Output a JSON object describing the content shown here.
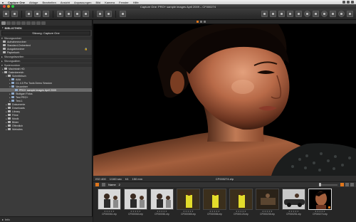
{
  "menubar": {
    "apple": "",
    "items": [
      "Capture One",
      "Ablage",
      "Bearbeiten",
      "Ansicht",
      "Anpassungen",
      "Bild",
      "Kamera",
      "Fenster",
      "Hilfe"
    ]
  },
  "window": {
    "title": "Capture One: PRO+ sample images April 2009 – CF000274"
  },
  "sidebar": {
    "panel_title": "BIBLIOTHEK",
    "catalog_name": "Sitzung: Capture One",
    "section_sitzungsordner": "Sitzungsordner",
    "session_items": [
      {
        "label": "Aufnahmeordner",
        "lock": ""
      },
      {
        "label": "Standard-Ordnertext",
        "lock": ""
      },
      {
        "label": "Ausgabeordner",
        "lock": "🔒"
      },
      {
        "label": "Papierkorb",
        "lock": ""
      }
    ],
    "section_favoriten": "Sitzungsfavoriten",
    "section_alben": "Sitzungsalben",
    "section_systemordner": "Systemordner",
    "tree": [
      {
        "indent": 0,
        "tw": "▸",
        "label": "Macintosh HD",
        "sel": false
      },
      {
        "indent": 0,
        "tw": "▾",
        "label": "Datenbereich",
        "sel": false
      },
      {
        "indent": 1,
        "tw": "▾",
        "label": "Schreibtisch",
        "sel": false
      },
      {
        "indent": 2,
        "tw": "▸",
        "label": "AAA",
        "sel": false
      },
      {
        "indent": 2,
        "tw": "▸",
        "label": "C1 4.5 Pro Tools Demo Session",
        "sel": false
      },
      {
        "indent": 2,
        "tw": "▾",
        "label": "Neuordner",
        "sel": false
      },
      {
        "indent": 3,
        "tw": "",
        "label": "PRO+ sample images April 2009",
        "sel": true
      },
      {
        "indent": 2,
        "tw": "▸",
        "label": "Stuttgart Fotos",
        "sel": false
      },
      {
        "indent": 2,
        "tw": "▸",
        "label": "Test PRO+",
        "sel": false
      },
      {
        "indent": 2,
        "tw": "▸",
        "label": "Test-1",
        "sel": false
      },
      {
        "indent": 1,
        "tw": "▸",
        "label": "Dokumente",
        "sel": false
      },
      {
        "indent": 1,
        "tw": "▸",
        "label": "Downloads",
        "sel": false
      },
      {
        "indent": 1,
        "tw": "▸",
        "label": "Library",
        "sel": false
      },
      {
        "indent": 1,
        "tw": "▸",
        "label": "Filme",
        "sel": false
      },
      {
        "indent": 1,
        "tw": "▸",
        "label": "Musik",
        "sel": false
      },
      {
        "indent": 1,
        "tw": "▸",
        "label": "Bilder",
        "sel": false
      },
      {
        "indent": 1,
        "tw": "▸",
        "label": "Öffentlich",
        "sel": false
      },
      {
        "indent": 1,
        "tw": "▸",
        "label": "Websites",
        "sel": false
      }
    ],
    "bottom_label": "Info"
  },
  "viewer": {
    "iso": "ISO 400",
    "shutter": "1/160 sec",
    "aperture": "f/4",
    "focal": "150 mm",
    "filename": "CF000274.eip"
  },
  "browser": {
    "name_label": "Name",
    "count": "2",
    "thumbs": [
      {
        "cap": "CF000061.eip",
        "kind": "studio",
        "sel": false
      },
      {
        "cap": "CF000063.eip",
        "kind": "studio",
        "sel": false
      },
      {
        "cap": "CF000081.eip",
        "kind": "studio",
        "sel": false
      },
      {
        "cap": "CF000085.eip",
        "kind": "yellow",
        "sel": false
      },
      {
        "cap": "CF000086.eip",
        "kind": "yellow",
        "sel": false
      },
      {
        "cap": "CF000125.eip",
        "kind": "yellow",
        "sel": false
      },
      {
        "cap": "CF000235.eip",
        "kind": "dark",
        "sel": false
      },
      {
        "cap": "CF000251.eip",
        "kind": "car",
        "sel": false
      },
      {
        "cap": "CF000274.eip",
        "kind": "portrait",
        "sel": true
      }
    ],
    "stars": "★★★★★"
  },
  "colors": {
    "accent": "#e0761b",
    "background": "#1a1a1a",
    "panel": "#3b3b3b"
  }
}
